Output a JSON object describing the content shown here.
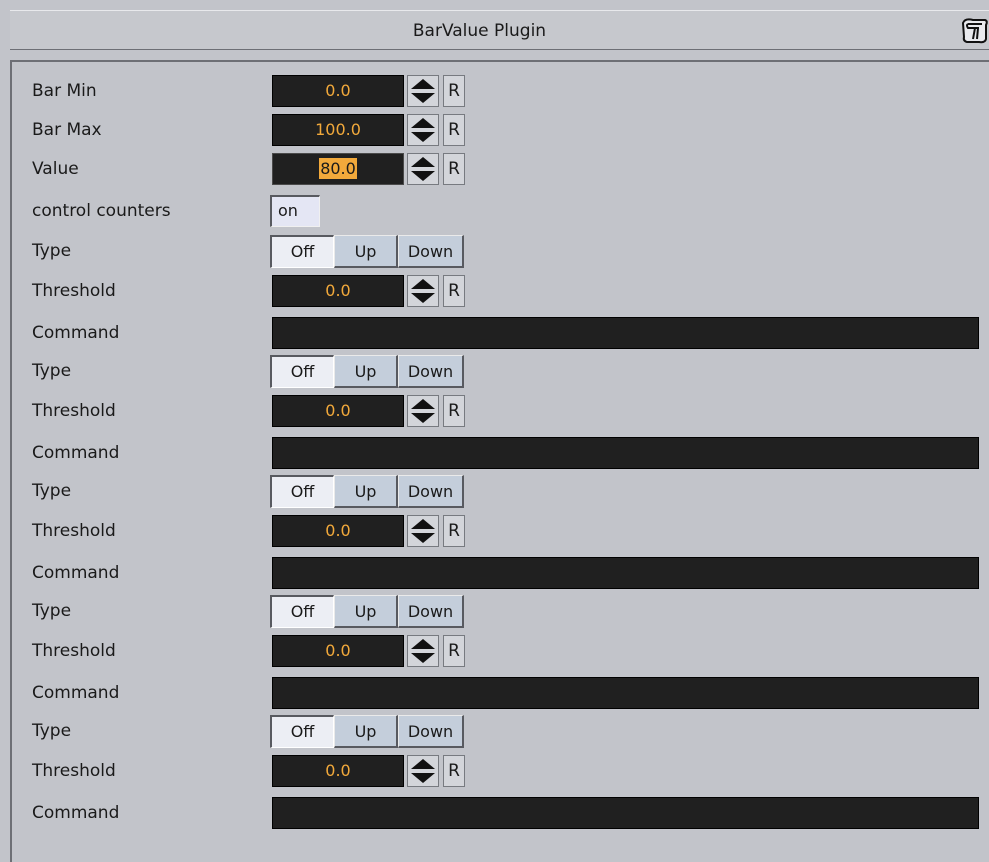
{
  "window": {
    "title": "BarValue Plugin",
    "help_icon": "help-book-icon"
  },
  "fields": {
    "bar_min": {
      "label": "Bar Min",
      "value": "0.0",
      "reset": "R"
    },
    "bar_max": {
      "label": "Bar Max",
      "value": "100.0",
      "reset": "R"
    },
    "value": {
      "label": "Value",
      "value": "80.0",
      "reset": "R"
    },
    "control_counters": {
      "label": "control counters",
      "state": "on"
    }
  },
  "counters": [
    {
      "type_label": "Type",
      "options": [
        "Off",
        "Up",
        "Down"
      ],
      "selected": "Off",
      "threshold_label": "Threshold",
      "threshold": "0.0",
      "reset": "R",
      "command_label": "Command",
      "command": ""
    },
    {
      "type_label": "Type",
      "options": [
        "Off",
        "Up",
        "Down"
      ],
      "selected": "Off",
      "threshold_label": "Threshold",
      "threshold": "0.0",
      "reset": "R",
      "command_label": "Command",
      "command": ""
    },
    {
      "type_label": "Type",
      "options": [
        "Off",
        "Up",
        "Down"
      ],
      "selected": "Off",
      "threshold_label": "Threshold",
      "threshold": "0.0",
      "reset": "R",
      "command_label": "Command",
      "command": ""
    },
    {
      "type_label": "Type",
      "options": [
        "Off",
        "Up",
        "Down"
      ],
      "selected": "Off",
      "threshold_label": "Threshold",
      "threshold": "0.0",
      "reset": "R",
      "command_label": "Command",
      "command": ""
    },
    {
      "type_label": "Type",
      "options": [
        "Off",
        "Up",
        "Down"
      ],
      "selected": "Off",
      "threshold_label": "Threshold",
      "threshold": "0.0",
      "reset": "R",
      "command_label": "Command",
      "command": ""
    }
  ],
  "colors": {
    "panel_bg": "#c2c4ca",
    "field_bg": "#202020",
    "field_text": "#f2a93b",
    "toggle_on_bg": "#e4e6f4",
    "segment_bg": "#c4cedb"
  }
}
